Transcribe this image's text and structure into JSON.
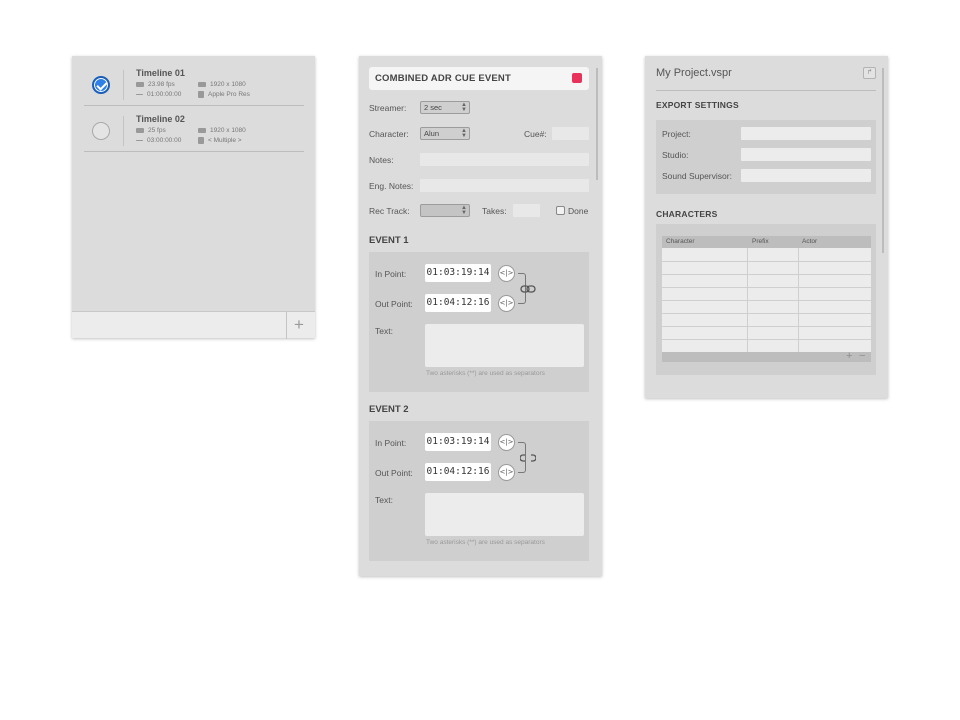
{
  "timelines": {
    "items": [
      {
        "name": "Timeline 01",
        "fps": "23.98 fps",
        "start": "01:00:00:00",
        "resolution": "1920 x 1080",
        "codec": "Apple Pro Res",
        "selected": true
      },
      {
        "name": "Timeline 02",
        "fps": "25 fps",
        "start": "03:00:00:00",
        "resolution": "1920 x 1080",
        "codec": "< Multiple >",
        "selected": false
      }
    ],
    "add_label": "+"
  },
  "cue": {
    "title": "COMBINED ADR CUE EVENT",
    "flag_color": "#e8325a",
    "streamer_label": "Streamer:",
    "streamer_value": "2 sec",
    "character_label": "Character:",
    "character_value": "Alun",
    "cue_num_label": "Cue#:",
    "notes_label": "Notes:",
    "eng_notes_label": "Eng. Notes:",
    "rec_track_label": "Rec Track:",
    "takes_label": "Takes:",
    "done_label": "Done",
    "events": [
      {
        "title": "EVENT 1",
        "in_label": "In Point:",
        "in_value": "01:03:19:14",
        "out_label": "Out Point:",
        "out_value": "01:04:12:16",
        "text_label": "Text:",
        "hint": "Two asterisks (**) are used as separators",
        "linked": true
      },
      {
        "title": "EVENT 2",
        "in_label": "In Point:",
        "in_value": "01:03:19:14",
        "out_label": "Out Point:",
        "out_value": "01:04:12:16",
        "text_label": "Text:",
        "hint": "Two asterisks (**) are used as separators",
        "linked": false
      }
    ]
  },
  "project": {
    "title": "My Project.vspr",
    "export_title": "EXPORT SETTINGS",
    "project_label": "Project:",
    "studio_label": "Studio:",
    "supervisor_label": "Sound Supervisor:",
    "characters_title": "CHARACTERS",
    "columns": [
      "Character",
      "Prefix",
      "Actor"
    ],
    "add_label": "+",
    "remove_label": "−"
  },
  "colors": {
    "accent": "#2e7fe8",
    "flag": "#e8325a",
    "panel": "#dcdcdc"
  }
}
